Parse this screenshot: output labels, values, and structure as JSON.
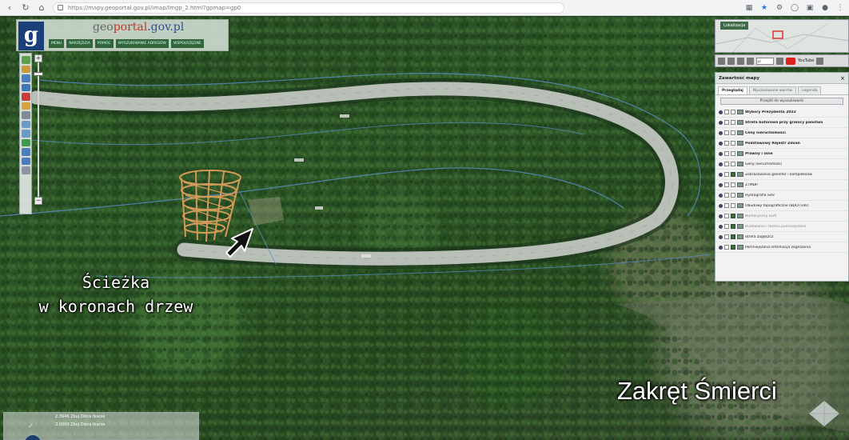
{
  "browser": {
    "url": "https://mapy.geoportal.gov.pl/imap/Imgp_2.html?gpmap=gp0",
    "icons": [
      "back-icon",
      "reload-icon",
      "home-icon",
      "star-icon",
      "extension-icon",
      "menu-icon"
    ]
  },
  "geoportal": {
    "brand_geo": "geo",
    "brand_portal": "portal",
    "brand_domain": ".gov.pl",
    "logo_letter": "g",
    "nav_items": [
      "MENU",
      "NARZĘDZIA",
      "POMOC",
      "WYSZUKIWANIE ADRESÓW",
      "WSPÓŁRZĘDNE"
    ]
  },
  "minimap": {
    "label": "Lokalizacja"
  },
  "share_bar": {
    "select_value": "pl",
    "youtube_text": "YouTube"
  },
  "layers_panel": {
    "title": "Zawartość mapy",
    "tabs": [
      "Przeglądaj",
      "Wyszukiwanie warstw",
      "Legenda"
    ],
    "active_tab": 0,
    "add_button": "Przejdź do wyszukiwarki",
    "rows": [
      {
        "label": "Wybory Prezydenta 2022",
        "checked": false,
        "bold": true,
        "dim": false
      },
      {
        "label": "Strefa buforowa przy granicy państwa",
        "checked": false,
        "bold": true,
        "dim": false
      },
      {
        "label": "Ceny nieruchomości",
        "checked": false,
        "bold": true,
        "dim": false
      },
      {
        "label": "Podstawowy Rejestr Zmian",
        "checked": false,
        "bold": true,
        "dim": false
      },
      {
        "label": "Prawny i inne",
        "checked": false,
        "bold": true,
        "dim": false
      },
      {
        "label": "Geny nieruchomości",
        "checked": false,
        "bold": false,
        "dim": false
      },
      {
        "label": "Zobrazowania geoinfor i kompleksów",
        "checked": true,
        "bold": false,
        "dim": false
      },
      {
        "label": "ZTMDP",
        "checked": false,
        "bold": false,
        "dim": false
      },
      {
        "label": "Hydrografia Sieć",
        "checked": false,
        "bold": false,
        "dim": false
      },
      {
        "label": "Obudowy topograficzne (BDOT10k)",
        "checked": false,
        "bold": false,
        "dim": false
      },
      {
        "label": "Numeryczny SLM",
        "checked": true,
        "bold": false,
        "dim": true
      },
      {
        "label": "Budowanie i terenu pomniejszone",
        "checked": true,
        "bold": false,
        "dim": true
      },
      {
        "label": "Strefa zagęszcz.",
        "checked": true,
        "bold": false,
        "dim": false
      },
      {
        "label": "Pomniejszona informacja zagrożenia",
        "checked": true,
        "bold": false,
        "dim": false
      }
    ]
  },
  "captions": {
    "tower_line1": "Ścieżka",
    "tower_line2": "w koronach drzew",
    "curve": "Zakręt Śmierci"
  },
  "scale": {
    "line1": "2.3946 Zbuj Dibra tkanie",
    "line2": "2.0000 Zbuj Dibra tkanie"
  },
  "colors": {
    "road": "#c9cdc8",
    "tower": "#d49a59",
    "boundary": "#5b8fc7",
    "panel_bg": "#f1f2f1",
    "logo_bg": "#1b3f78"
  }
}
